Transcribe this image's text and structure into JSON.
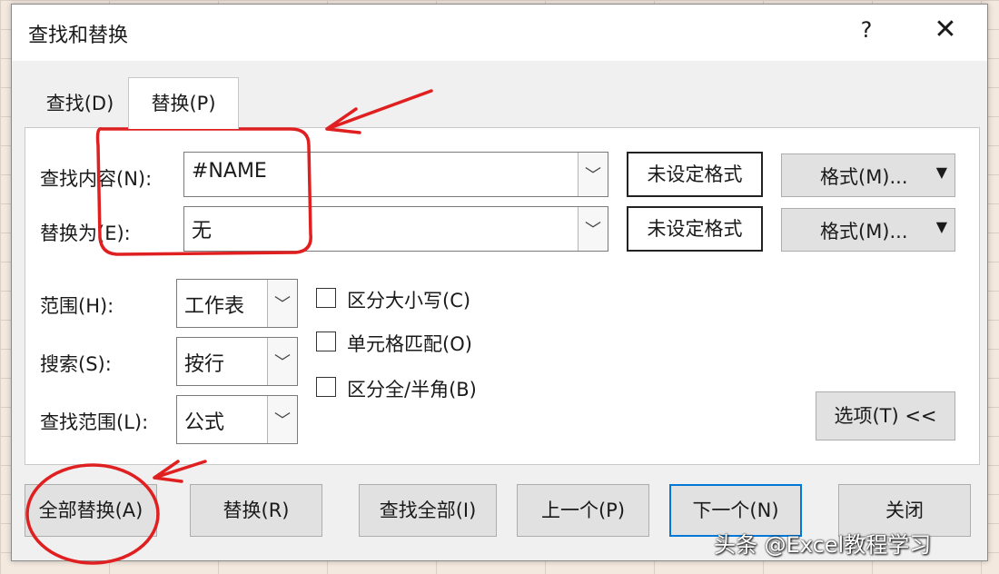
{
  "dialog": {
    "title": "查找和替换",
    "help": "?",
    "close": "✕"
  },
  "tabs": [
    {
      "label": "查找(D)",
      "active": false
    },
    {
      "label": "替换(P)",
      "active": true
    }
  ],
  "fields": {
    "find_label": "查找内容(N):",
    "find_value": "#NAME",
    "find_format_status": "未设定格式",
    "find_format_button": "格式(M)...",
    "replace_label": "替换为(E):",
    "replace_value": "无",
    "replace_format_status": "未设定格式",
    "replace_format_button": "格式(M)..."
  },
  "options": {
    "scope_label": "范围(H):",
    "scope_value": "工作表",
    "search_label": "搜索(S):",
    "search_value": "按行",
    "lookin_label": "查找范围(L):",
    "lookin_value": "公式",
    "match_case": "区分大小写(C)",
    "match_cell": "单元格匹配(O)",
    "match_byte": "区分全/半角(B)",
    "options_button": "选项(T) <<"
  },
  "buttons": {
    "replace_all": "全部替换(A)",
    "replace": "替换(R)",
    "find_all": "查找全部(I)",
    "prev": "上一个(P)",
    "next": "下一个(N)",
    "close": "关闭"
  },
  "watermark": "头条 @Excel教程学习",
  "colors": {
    "annotation": "#e02020",
    "default_button_border": "#0078d7"
  }
}
